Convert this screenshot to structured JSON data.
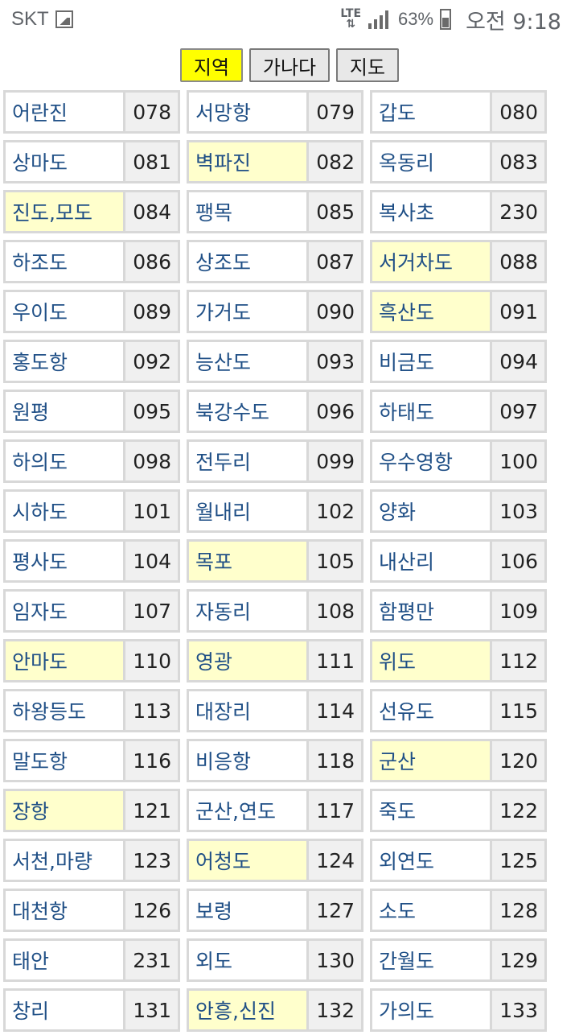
{
  "status_bar": {
    "carrier": "SKT",
    "network": "LTE",
    "battery": "63%",
    "time": "오전 9:18",
    "icons": [
      "gallery-icon",
      "data-arrows-icon",
      "signal-icon",
      "battery-icon"
    ]
  },
  "tabs": [
    {
      "label": "지역",
      "active": true
    },
    {
      "label": "가나다",
      "active": false
    },
    {
      "label": "지도",
      "active": false
    }
  ],
  "colors": {
    "active_tab": "#ffff00",
    "highlight": "#ffffcc",
    "link": "#1f4f86",
    "border": "#d8d8d8"
  },
  "stations": [
    [
      {
        "name": "어란진",
        "code": "078",
        "hl": false
      },
      {
        "name": "서망항",
        "code": "079",
        "hl": false
      },
      {
        "name": "갑도",
        "code": "080",
        "hl": false
      }
    ],
    [
      {
        "name": "상마도",
        "code": "081",
        "hl": false
      },
      {
        "name": "벽파진",
        "code": "082",
        "hl": true
      },
      {
        "name": "옥동리",
        "code": "083",
        "hl": false
      }
    ],
    [
      {
        "name": "진도,모도",
        "code": "084",
        "hl": true
      },
      {
        "name": "팽목",
        "code": "085",
        "hl": false
      },
      {
        "name": "복사초",
        "code": "230",
        "hl": false
      }
    ],
    [
      {
        "name": "하조도",
        "code": "086",
        "hl": false
      },
      {
        "name": "상조도",
        "code": "087",
        "hl": false
      },
      {
        "name": "서거차도",
        "code": "088",
        "hl": true
      }
    ],
    [
      {
        "name": "우이도",
        "code": "089",
        "hl": false
      },
      {
        "name": "가거도",
        "code": "090",
        "hl": false
      },
      {
        "name": "흑산도",
        "code": "091",
        "hl": true
      }
    ],
    [
      {
        "name": "홍도항",
        "code": "092",
        "hl": false
      },
      {
        "name": "능산도",
        "code": "093",
        "hl": false
      },
      {
        "name": "비금도",
        "code": "094",
        "hl": false
      }
    ],
    [
      {
        "name": "원평",
        "code": "095",
        "hl": false
      },
      {
        "name": "북강수도",
        "code": "096",
        "hl": false
      },
      {
        "name": "하태도",
        "code": "097",
        "hl": false
      }
    ],
    [
      {
        "name": "하의도",
        "code": "098",
        "hl": false
      },
      {
        "name": "전두리",
        "code": "099",
        "hl": false
      },
      {
        "name": "우수영항",
        "code": "100",
        "hl": false
      }
    ],
    [
      {
        "name": "시하도",
        "code": "101",
        "hl": false
      },
      {
        "name": "월내리",
        "code": "102",
        "hl": false
      },
      {
        "name": "양화",
        "code": "103",
        "hl": false
      }
    ],
    [
      {
        "name": "평사도",
        "code": "104",
        "hl": false
      },
      {
        "name": "목포",
        "code": "105",
        "hl": true
      },
      {
        "name": "내산리",
        "code": "106",
        "hl": false
      }
    ],
    [
      {
        "name": "임자도",
        "code": "107",
        "hl": false
      },
      {
        "name": "자동리",
        "code": "108",
        "hl": false
      },
      {
        "name": "함평만",
        "code": "109",
        "hl": false
      }
    ],
    [
      {
        "name": "안마도",
        "code": "110",
        "hl": true
      },
      {
        "name": "영광",
        "code": "111",
        "hl": true
      },
      {
        "name": "위도",
        "code": "112",
        "hl": true
      }
    ],
    [
      {
        "name": "하왕등도",
        "code": "113",
        "hl": false
      },
      {
        "name": "대장리",
        "code": "114",
        "hl": false
      },
      {
        "name": "선유도",
        "code": "115",
        "hl": false
      }
    ],
    [
      {
        "name": "말도항",
        "code": "116",
        "hl": false
      },
      {
        "name": "비응항",
        "code": "118",
        "hl": false
      },
      {
        "name": "군산",
        "code": "120",
        "hl": true
      }
    ],
    [
      {
        "name": "장항",
        "code": "121",
        "hl": true
      },
      {
        "name": "군산,연도",
        "code": "117",
        "hl": false
      },
      {
        "name": "죽도",
        "code": "122",
        "hl": false
      }
    ],
    [
      {
        "name": "서천,마량",
        "code": "123",
        "hl": false
      },
      {
        "name": "어청도",
        "code": "124",
        "hl": true
      },
      {
        "name": "외연도",
        "code": "125",
        "hl": false
      }
    ],
    [
      {
        "name": "대천항",
        "code": "126",
        "hl": false
      },
      {
        "name": "보령",
        "code": "127",
        "hl": false
      },
      {
        "name": "소도",
        "code": "128",
        "hl": false
      }
    ],
    [
      {
        "name": "태안",
        "code": "231",
        "hl": false
      },
      {
        "name": "외도",
        "code": "130",
        "hl": false
      },
      {
        "name": "간월도",
        "code": "129",
        "hl": false
      }
    ],
    [
      {
        "name": "창리",
        "code": "131",
        "hl": false
      },
      {
        "name": "안흥,신진",
        "code": "132",
        "hl": true
      },
      {
        "name": "가의도",
        "code": "133",
        "hl": false
      }
    ]
  ]
}
